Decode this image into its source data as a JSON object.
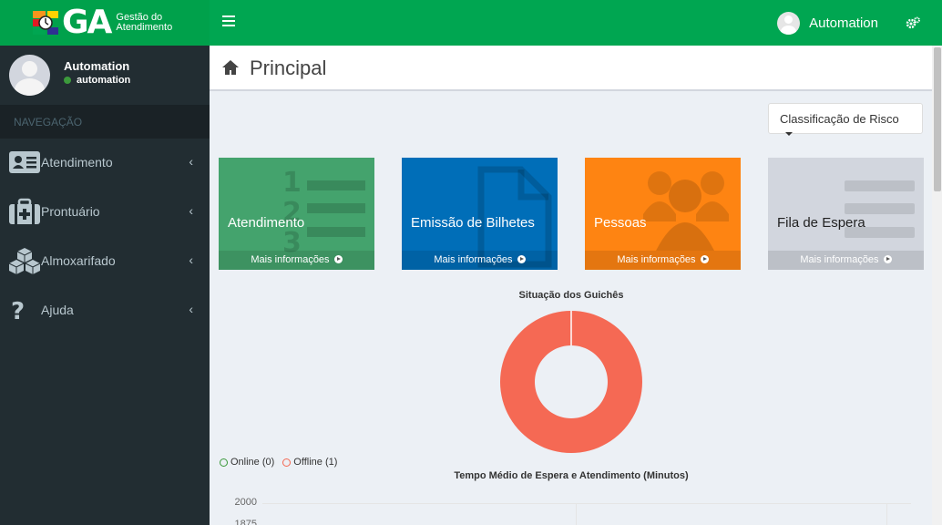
{
  "brand": {
    "logo_text": "GA",
    "logo_subtitle_line1": "Gestão do",
    "logo_subtitle_line2": "Atendimento",
    "primary_color": "#00a651"
  },
  "topbar": {
    "user_name": "Automation"
  },
  "sidebar": {
    "user_name": "Automation",
    "user_status": "automation",
    "nav_header": "NAVEGAÇÃO",
    "items": [
      {
        "label": "Atendimento",
        "icon": "id-card-icon"
      },
      {
        "label": "Prontuário",
        "icon": "medkit-icon"
      },
      {
        "label": "Almoxarifado",
        "icon": "cubes-icon"
      },
      {
        "label": "Ajuda",
        "icon": "question-icon"
      }
    ]
  },
  "header": {
    "title": "Principal"
  },
  "toolbar": {
    "risk_dropdown_label": "Classificação de Risco"
  },
  "tiles": [
    {
      "label": "Atendimento",
      "footer": "Mais informações",
      "color": "#44a36d"
    },
    {
      "label": "Emissão de Bilhetes",
      "footer": "Mais informações",
      "color": "#006eb8"
    },
    {
      "label": "Pessoas",
      "footer": "Mais informações",
      "color": "#fe8412"
    },
    {
      "label": "Fila de Espera",
      "footer": "Mais informações",
      "color": "#d2d6de"
    }
  ],
  "chart_data": [
    {
      "type": "pie",
      "title": "Situação dos Guichês",
      "categories": [
        "Online (0)",
        "Offline (1)"
      ],
      "values": [
        0,
        1
      ],
      "colors": [
        "#3c9a3c",
        "#f56954"
      ],
      "legend": "bottom-left"
    },
    {
      "type": "bar",
      "title": "Tempo Médio de Espera e Atendimento (Minutos)",
      "y_ticks": [
        "2000",
        "1875"
      ],
      "grid": true
    }
  ]
}
